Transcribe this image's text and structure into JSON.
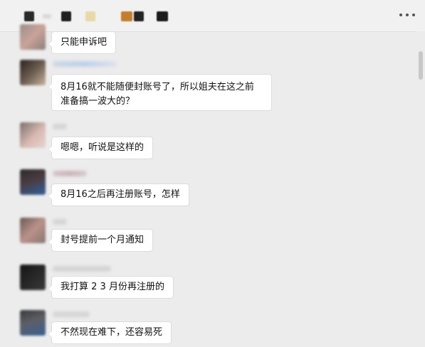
{
  "window": {
    "more_icon": "more-dots-icon"
  },
  "messages": [
    {
      "text": "只能申诉吧"
    },
    {
      "text": "8月16就不能随便封账号了，所以姐夫在这之前准备搞一波大的？"
    },
    {
      "text": "嗯嗯，听说是这样的"
    },
    {
      "text": "8月16之后再注册账号，怎样"
    },
    {
      "text": "封号提前一个月通知"
    },
    {
      "text": "我打算 2 3 月份再注册的"
    },
    {
      "text": "不然现在难下，还容易死"
    }
  ]
}
